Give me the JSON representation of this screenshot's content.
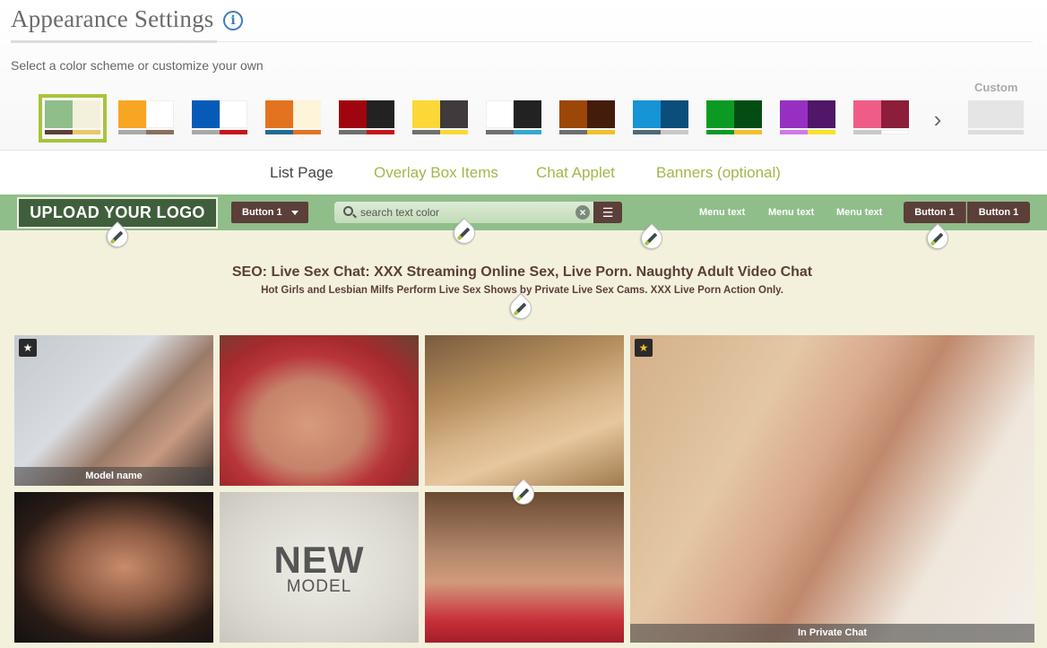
{
  "header": {
    "title": "Appearance Settings",
    "info_icon": "info-icon",
    "info_glyph": "i",
    "subtitle": "Select a color scheme or customize your own",
    "custom_label": "Custom",
    "next_icon": "chevron-right-icon",
    "next_glyph": "›"
  },
  "color_schemes": [
    {
      "block_left": "#8fbe8a",
      "block_right": "#f3f1dc",
      "bar_left": "#5b3f38",
      "bar_right": "#e7c96a",
      "selected": true
    },
    {
      "block_left": "#f7a623",
      "block_right": "#ffffff",
      "bar_left": "#a9a9a9",
      "bar_right": "#8b6f5e"
    },
    {
      "block_left": "#075bb8",
      "block_right": "#ffffff",
      "bar_left": "#a9a9a9",
      "bar_right": "#c4161c"
    },
    {
      "block_left": "#e37321",
      "block_right": "#fdf4da",
      "bar_left": "#1f6c8f",
      "bar_right": "#e37321"
    },
    {
      "block_left": "#a0050f",
      "block_right": "#222222",
      "bar_left": "#6f6f6f",
      "bar_right": "#c4161c"
    },
    {
      "block_left": "#fbd837",
      "block_right": "#403a3c",
      "bar_left": "#6f6f6f",
      "bar_right": "#fbd837"
    },
    {
      "block_left": "#ffffff",
      "block_right": "#222222",
      "bar_left": "#6f6f6f",
      "bar_right": "#33a9d1"
    },
    {
      "block_left": "#9c4607",
      "block_right": "#431c0c",
      "bar_left": "#6f6f6f",
      "bar_right": "#f2c02a"
    },
    {
      "block_left": "#1694d5",
      "block_right": "#0b4e7a",
      "bar_left": "#4f6a7a",
      "bar_right": "#c9c9c9"
    },
    {
      "block_left": "#0b9b22",
      "block_right": "#034d14",
      "bar_left": "#0b9b22",
      "bar_right": "#f2c02a"
    },
    {
      "block_left": "#9730c2",
      "block_right": "#501768",
      "bar_left": "#d079e8",
      "bar_right": "#fbe02a"
    },
    {
      "block_left": "#ef5d87",
      "block_right": "#8c1e3a",
      "bar_left": "#c9c9c9",
      "bar_right": "#ffffff"
    },
    {
      "block_left": "#e5e5e5",
      "block_right": "#e5e5e5",
      "bar_left": "#dddddd",
      "bar_right": "#dddddd"
    }
  ],
  "tabs": [
    {
      "label": "List Page",
      "active": true
    },
    {
      "label": "Overlay Box Items"
    },
    {
      "label": "Chat Applet"
    },
    {
      "label": "Banners (optional)"
    }
  ],
  "preview": {
    "logo_text": "UPLOAD YOUR LOGO",
    "dropdown_button": "Button 1",
    "search_placeholder": "search text color",
    "clear_glyph": "×",
    "list_glyph": "☰",
    "menu_items": [
      "Menu text",
      "Menu text",
      "Menu text"
    ],
    "right_buttons": [
      "Button 1",
      "Button 1"
    ],
    "seo_title": "SEO: Live Sex Chat: XXX Streaming Online Sex, Live Porn. Naughty Adult Video Chat",
    "seo_subtitle": "Hot Girls and Lesbian Milfs Perform Live Sex Shows by Private Live Sex Cams. XXX Live Porn Action Only.",
    "star_glyph": "★",
    "tiles": [
      {
        "caption": "Model name",
        "star": true
      },
      {
        "caption": ""
      },
      {
        "caption": ""
      },
      {
        "caption": "In Private Chat",
        "star": true
      },
      {
        "caption": ""
      },
      {
        "caption": ""
      }
    ],
    "new_model": {
      "big": "NEW",
      "small": "MODEL"
    },
    "colors": {
      "nav_bg": "#8fbe8a",
      "page_bg": "#f3f1dc",
      "button_bg": "#5b3f38",
      "accent": "#a8c43a"
    }
  }
}
